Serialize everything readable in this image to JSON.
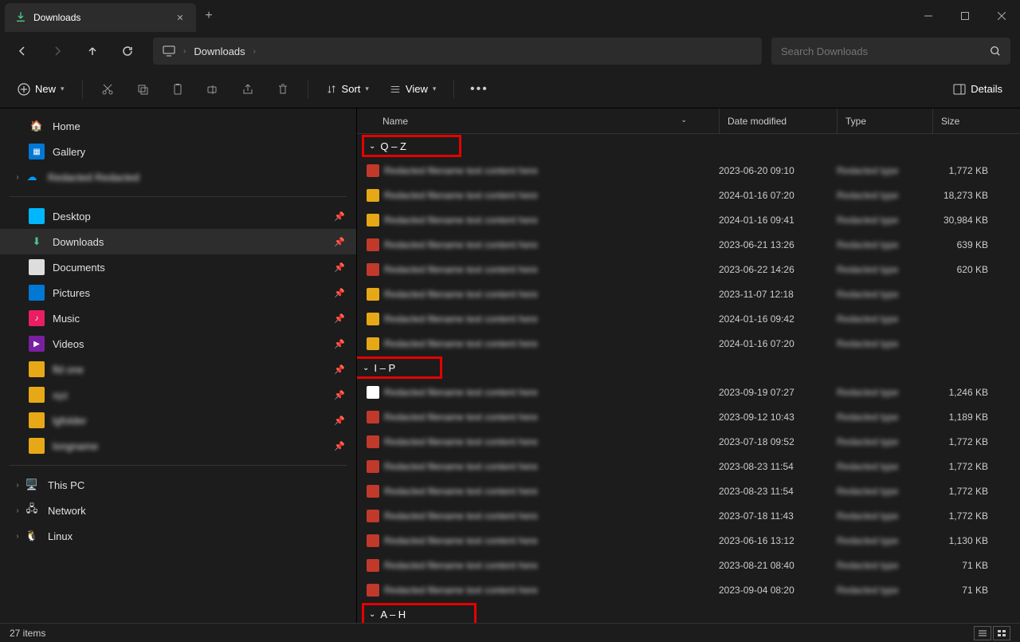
{
  "tab": {
    "title": "Downloads"
  },
  "breadcrumb": {
    "segment": "Downloads"
  },
  "search": {
    "placeholder": "Search Downloads"
  },
  "cmdbar": {
    "new_label": "New",
    "sort_label": "Sort",
    "view_label": "View",
    "details_label": "Details"
  },
  "sidebar": {
    "home": "Home",
    "gallery": "Gallery",
    "user_item": "Redacted Redacted",
    "desktop": "Desktop",
    "downloads": "Downloads",
    "documents": "Documents",
    "pictures": "Pictures",
    "music": "Music",
    "videos": "Videos",
    "extra1": "fld one",
    "extra2": "xyz",
    "extra3": "lgfolder",
    "extra4": "longname",
    "thispc": "This PC",
    "network": "Network",
    "linux": "Linux"
  },
  "columns": {
    "name": "Name",
    "date": "Date modified",
    "type": "Type",
    "size": "Size"
  },
  "groups": {
    "g1": "Q – Z",
    "g2": "I – P",
    "g3": "A – H"
  },
  "files": {
    "qz": [
      {
        "date": "2023-06-20 09:10",
        "size": "1,772 KB",
        "icon": "#c0392b"
      },
      {
        "date": "2024-01-16 07:20",
        "size": "18,273 KB",
        "icon": "#e6a817"
      },
      {
        "date": "2024-01-16 09:41",
        "size": "30,984 KB",
        "icon": "#e6a817"
      },
      {
        "date": "2023-06-21 13:26",
        "size": "639 KB",
        "icon": "#c0392b"
      },
      {
        "date": "2023-06-22 14:26",
        "size": "620 KB",
        "icon": "#c0392b"
      },
      {
        "date": "2023-11-07 12:18",
        "size": "",
        "icon": "#e6a817"
      },
      {
        "date": "2024-01-16 09:42",
        "size": "",
        "icon": "#e6a817"
      },
      {
        "date": "2024-01-16 07:20",
        "size": "",
        "icon": "#e6a817"
      }
    ],
    "ip": [
      {
        "date": "2023-09-19 07:27",
        "size": "1,246 KB",
        "icon": "#ffffff"
      },
      {
        "date": "2023-09-12 10:43",
        "size": "1,189 KB",
        "icon": "#c0392b"
      },
      {
        "date": "2023-07-18 09:52",
        "size": "1,772 KB",
        "icon": "#c0392b"
      },
      {
        "date": "2023-08-23 11:54",
        "size": "1,772 KB",
        "icon": "#c0392b"
      },
      {
        "date": "2023-08-23 11:54",
        "size": "1,772 KB",
        "icon": "#c0392b"
      },
      {
        "date": "2023-07-18 11:43",
        "size": "1,772 KB",
        "icon": "#c0392b"
      },
      {
        "date": "2023-06-16 13:12",
        "size": "1,130 KB",
        "icon": "#c0392b"
      },
      {
        "date": "2023-08-21 08:40",
        "size": "71 KB",
        "icon": "#c0392b"
      },
      {
        "date": "2023-09-04 08:20",
        "size": "71 KB",
        "icon": "#c0392b"
      }
    ]
  },
  "status": {
    "items": "27 items"
  }
}
